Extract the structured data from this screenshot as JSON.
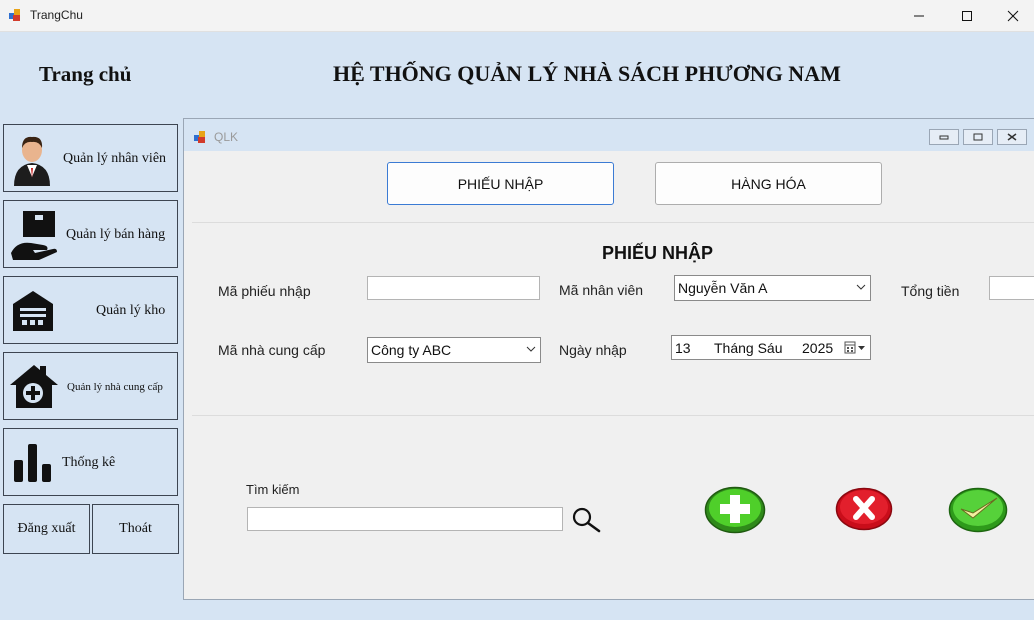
{
  "window": {
    "title": "TrangChu"
  },
  "header": {
    "left_title": "Trang chủ",
    "main_title": "HỆ THỐNG QUẢN LÝ NHÀ SÁCH PHƯƠNG NAM"
  },
  "nav": {
    "employees": "Quản lý nhân viên",
    "sales": "Quản lý bán hàng",
    "warehouse": "Quản lý kho",
    "suppliers": "Quản lý nhà cung cấp",
    "stats": "Thống kê",
    "logout": "Đăng xuất",
    "exit": "Thoát"
  },
  "child": {
    "title": "QLK",
    "tabs": {
      "phieu_nhap": "PHIẾU NHẬP",
      "hang_hoa": "HÀNG HÓA"
    },
    "form_title": "PHIẾU NHẬP",
    "labels": {
      "ma_phieu_nhap": "Mã phiếu nhập",
      "ma_nhan_vien": "Mã nhân viên",
      "tong_tien": "Tổng tiền",
      "ma_nha_cung_cap": "Mã nhà cung cấp",
      "ngay_nhap": "Ngày nhập",
      "tim_kiem": "Tìm kiếm"
    },
    "values": {
      "ma_phieu_nhap": "",
      "ma_nhan_vien": "Nguyễn Văn A",
      "tong_tien": "",
      "ma_nha_cung_cap": "Công ty ABC",
      "search": ""
    },
    "date": {
      "day": "13",
      "month": "Tháng Sáu",
      "year": "2025"
    }
  },
  "colors": {
    "background": "#d6e4f3",
    "add": "#3fbf1f",
    "delete": "#d4101e",
    "confirm": "#4ac12b"
  }
}
